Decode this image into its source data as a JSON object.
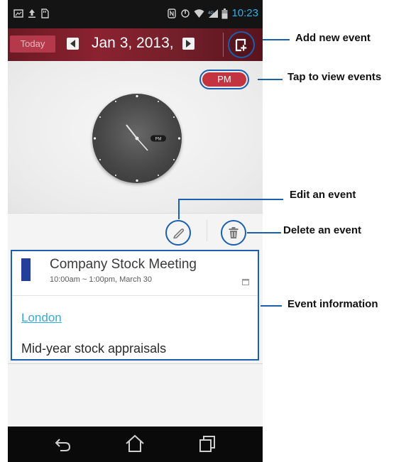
{
  "status_bar": {
    "time": "10:23",
    "icons": [
      "screenshot-icon",
      "upload-icon",
      "sd-card-icon",
      "nfc-icon",
      "sync-icon",
      "wifi-icon",
      "signal-icon",
      "battery-icon"
    ]
  },
  "toolbar": {
    "today_label": "Today",
    "date": "Jan 3, 2013,"
  },
  "clock": {
    "period_label": "PM",
    "face_badge": "PM"
  },
  "event": {
    "title": "Company Stock Meeting",
    "time": "10:00am ~ 1:00pm, March 30",
    "location": "London",
    "description": "Mid-year stock appraisals",
    "color": "#233f9a"
  },
  "annotations": {
    "add_new_event": "Add new event",
    "tap_to_view_events": "Tap to view events",
    "edit_an_event": "Edit an event",
    "delete_an_event": "Delete an event",
    "event_information": "Event information"
  },
  "colors": {
    "toolbar": "#7a1f2b",
    "accent": "#c2343f",
    "highlight": "#1b5fad",
    "link": "#3aa9d7",
    "clock_time": "#2fb0e6"
  }
}
